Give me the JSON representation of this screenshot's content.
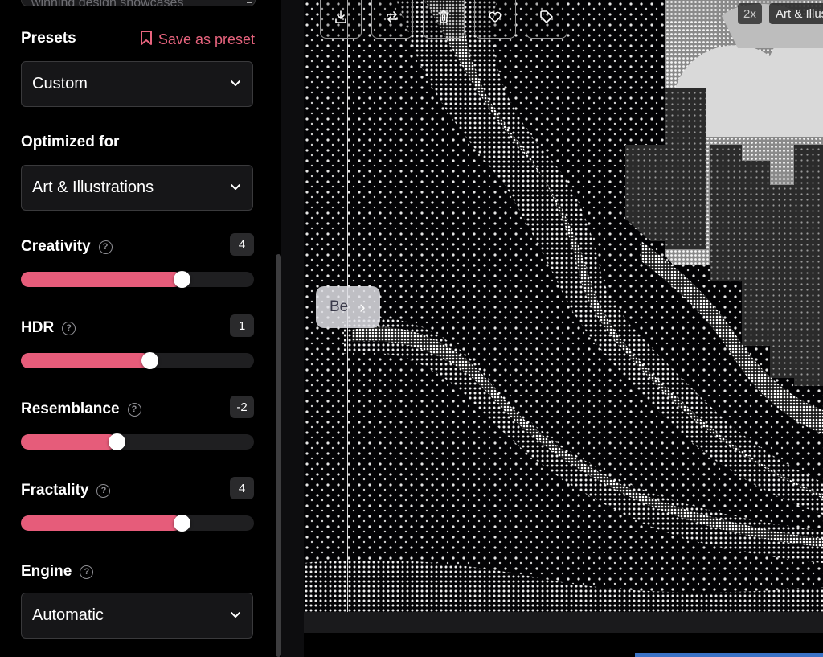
{
  "prompt": {
    "text": "winning design showcases"
  },
  "presets": {
    "title": "Presets",
    "save_label": "Save as preset",
    "selected": "Custom"
  },
  "optimized": {
    "title": "Optimized for",
    "selected": "Art & Illustrations"
  },
  "sliders": [
    {
      "label": "Creativity",
      "value": "4",
      "fraction": 0.69
    },
    {
      "label": "HDR",
      "value": "1",
      "fraction": 0.55
    },
    {
      "label": "Resemblance",
      "value": "-2",
      "fraction": 0.41
    },
    {
      "label": "Fractality",
      "value": "4",
      "fraction": 0.69
    }
  ],
  "engine": {
    "title": "Engine",
    "selected": "Automatic"
  },
  "image": {
    "scale_badge": "2x",
    "style_badge": "Art & Illustrations",
    "compare_label": "Be",
    "toolbar_icons": [
      "download-icon",
      "repeat-icon",
      "trash-icon",
      "heart-icon",
      "tag-icon"
    ]
  },
  "colors": {
    "accent": "#e65c7a",
    "background": "#000000"
  }
}
